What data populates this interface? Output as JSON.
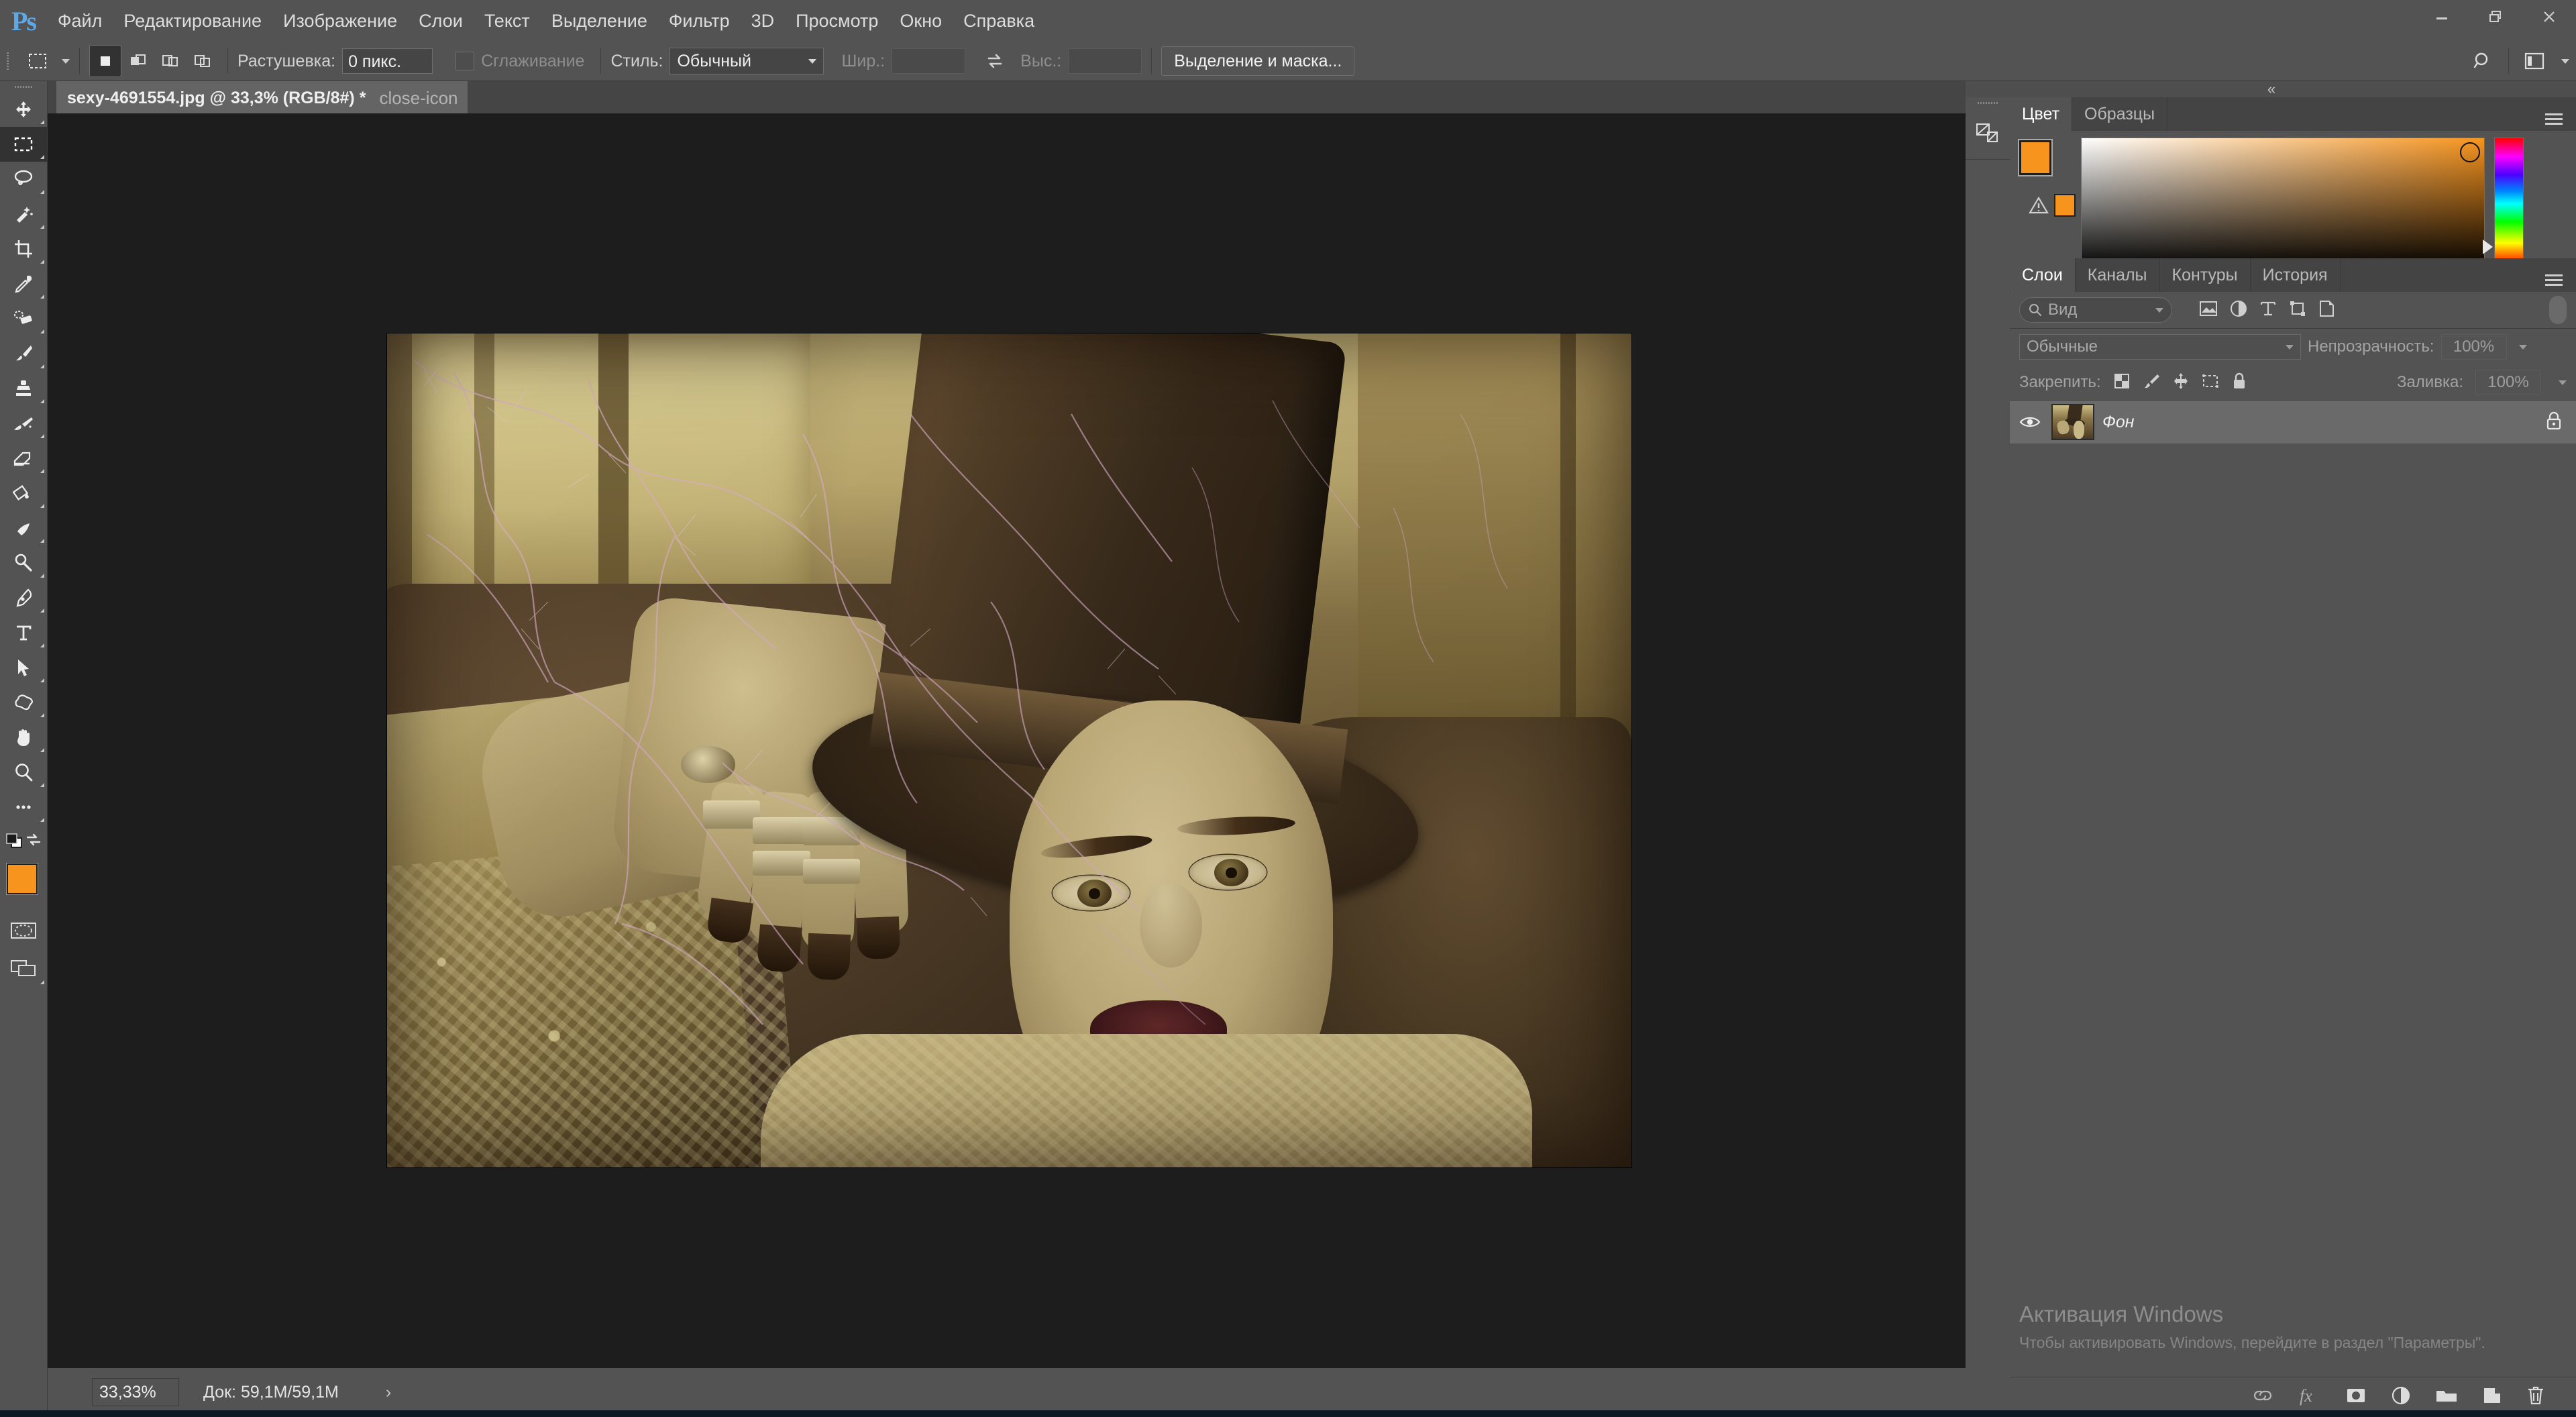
{
  "app": {
    "logo": "Ps"
  },
  "menubar": {
    "items": [
      {
        "label": "Файл"
      },
      {
        "label": "Редактирование"
      },
      {
        "label": "Изображение"
      },
      {
        "label": "Слои"
      },
      {
        "label": "Текст"
      },
      {
        "label": "Выделение"
      },
      {
        "label": "Фильтр"
      },
      {
        "label": "3D"
      },
      {
        "label": "Просмотр"
      },
      {
        "label": "Окно"
      },
      {
        "label": "Справка"
      }
    ]
  },
  "window_controls": {
    "minimize": "minimize-icon",
    "restore": "restore-icon",
    "close": "close-icon"
  },
  "options_bar": {
    "tool_preset_icon": "rectangular-marquee-icon",
    "selection_modes": [
      {
        "name": "new-selection",
        "active": true
      },
      {
        "name": "add-to-selection",
        "active": false
      },
      {
        "name": "subtract-from-selection",
        "active": false
      },
      {
        "name": "intersect-with-selection",
        "active": false
      }
    ],
    "feather_label": "Растушевка:",
    "feather_value": "0 пикс.",
    "antialias_label": "Сглаживание",
    "antialias_checked": false,
    "style_label": "Стиль:",
    "style_value": "Обычный",
    "width_label": "Шир.:",
    "width_value": "",
    "height_label": "Выс.:",
    "height_value": "",
    "swap_icon": "swap-dimensions-icon",
    "select_mask_button": "Выделение и маска...",
    "search_icon": "search-icon",
    "workspace_icon": "workspace-switcher-icon"
  },
  "toolbar": {
    "tools": [
      {
        "name": "move-tool",
        "active": false
      },
      {
        "name": "rectangular-marquee-tool",
        "active": true
      },
      {
        "name": "lasso-tool",
        "active": false
      },
      {
        "name": "quick-selection-tool",
        "active": false
      },
      {
        "name": "crop-tool",
        "active": false
      },
      {
        "name": "eyedropper-tool",
        "active": false
      },
      {
        "name": "spot-healing-brush-tool",
        "active": false
      },
      {
        "name": "brush-tool",
        "active": false
      },
      {
        "name": "clone-stamp-tool",
        "active": false
      },
      {
        "name": "history-brush-tool",
        "active": false
      },
      {
        "name": "eraser-tool",
        "active": false
      },
      {
        "name": "gradient-tool",
        "active": false
      },
      {
        "name": "blur-tool",
        "active": false
      },
      {
        "name": "dodge-tool",
        "active": false
      },
      {
        "name": "pen-tool",
        "active": false
      },
      {
        "name": "type-tool",
        "active": false
      },
      {
        "name": "path-selection-tool",
        "active": false
      },
      {
        "name": "custom-shape-tool",
        "active": false
      },
      {
        "name": "hand-tool",
        "active": false
      },
      {
        "name": "zoom-tool",
        "active": false
      },
      {
        "name": "edit-toolbar-tool",
        "active": false
      }
    ],
    "foreground_color": "#f7941e",
    "background_color": "#ffffff",
    "quick_mask_icon": "quick-mask-icon",
    "screen_mode_icon": "screen-mode-icon"
  },
  "document": {
    "tab_title": "sexy-4691554.jpg @ 33,3% (RGB/8#) *",
    "close_icon": "close-icon"
  },
  "status_bar": {
    "zoom": "33,33%",
    "doc_info": "Док: 59,1M/59,1M",
    "expand_arrow": "›"
  },
  "dock": {
    "collapse_icon": "«",
    "rail_items": [
      {
        "name": "properties-panel-icon"
      }
    ]
  },
  "color_panel": {
    "tabs": [
      {
        "label": "Цвет",
        "active": true
      },
      {
        "label": "Образцы",
        "active": false
      }
    ],
    "menu_icon": "panel-menu-icon",
    "foreground_color": "#f7941e",
    "background_color": "#ffffff",
    "out_of_gamut_icon": "gamut-warning-icon",
    "out_of_gamut_color": "#f7941e"
  },
  "layers_panel": {
    "tabs": [
      {
        "label": "Слои",
        "active": true
      },
      {
        "label": "Каналы",
        "active": false
      },
      {
        "label": "Контуры",
        "active": false
      },
      {
        "label": "История",
        "active": false
      }
    ],
    "menu_icon": "panel-menu-icon",
    "filter_placeholder": "Вид",
    "filter_icons": [
      {
        "name": "filter-pixel-icon"
      },
      {
        "name": "filter-adjustment-icon"
      },
      {
        "name": "filter-type-icon"
      },
      {
        "name": "filter-shape-icon"
      },
      {
        "name": "filter-smart-object-icon"
      }
    ],
    "blend_mode": "Обычные",
    "opacity_label": "Непрозрачность:",
    "opacity_value": "100%",
    "lock_label": "Закрепить:",
    "lock_icons": [
      {
        "name": "lock-transparent-pixels-icon"
      },
      {
        "name": "lock-image-pixels-icon"
      },
      {
        "name": "lock-position-icon"
      },
      {
        "name": "lock-artboard-nesting-icon"
      },
      {
        "name": "lock-all-icon"
      }
    ],
    "fill_label": "Заливка:",
    "fill_value": "100%",
    "layers": [
      {
        "name": "Фон",
        "visible": true,
        "locked": true
      }
    ],
    "footer_icons": [
      {
        "name": "link-layers-icon"
      },
      {
        "name": "layer-style-fx-icon"
      },
      {
        "name": "add-layer-mask-icon"
      },
      {
        "name": "new-adjustment-layer-icon"
      },
      {
        "name": "new-group-icon"
      },
      {
        "name": "new-layer-icon"
      },
      {
        "name": "delete-layer-icon"
      }
    ]
  },
  "windows_activation": {
    "title": "Активация Windows",
    "subtitle": "Чтобы активировать Windows, перейдите в раздел \"Параметры\"."
  }
}
